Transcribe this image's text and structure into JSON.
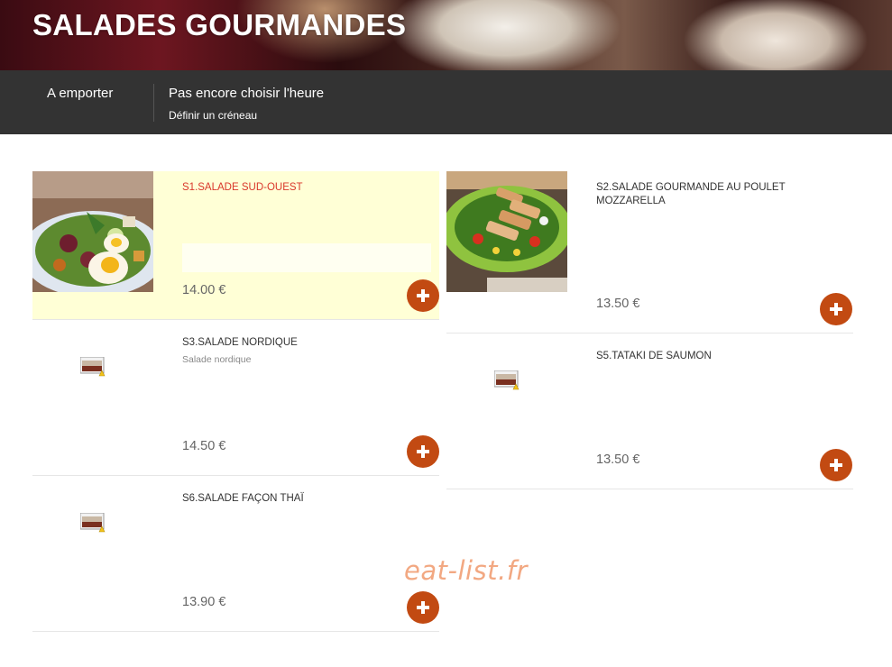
{
  "header": {
    "title": "SALADES GOURMANDES"
  },
  "order_bar": {
    "mode": "A emporter",
    "time_status": "Pas encore choisir l'heure",
    "slot_link": "Définir un créneau"
  },
  "products": [
    {
      "name": "S1.SALADE SUD-OUEST",
      "description": "",
      "price": "14.00 €"
    },
    {
      "name": "S2.SALADE GOURMANDE AU POULET MOZZARELLA",
      "description": "",
      "price": "13.50 €"
    },
    {
      "name": "S3.SALADE NORDIQUE",
      "description": "Salade nordique",
      "price": "14.50 €"
    },
    {
      "name": "S5.TATAKI DE SAUMON",
      "description": "",
      "price": "13.50 €"
    },
    {
      "name": "S6.SALADE FAÇON THAÏ",
      "description": "",
      "price": "13.90 €"
    }
  ],
  "watermark": "eat-list.fr",
  "colors": {
    "accent": "#c24a12",
    "highlight": "#ffffd6",
    "bar": "#333333",
    "selected_name": "#d9372b"
  },
  "icons": {
    "add": "plus-icon",
    "missing_image": "broken-image-icon"
  }
}
